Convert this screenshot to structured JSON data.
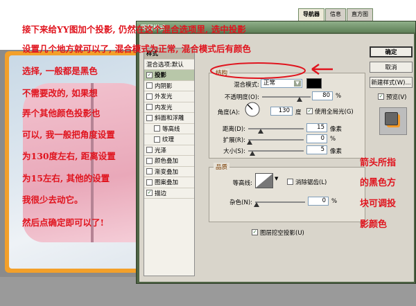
{
  "navigator": {
    "tabs": [
      "导航器",
      "信息",
      "直方图"
    ],
    "active": 0
  },
  "dialog": {
    "title": "图层样式",
    "style_list": {
      "header": "样式",
      "default_item": "混合选项:默认",
      "items": [
        {
          "label": "投影",
          "checked": true,
          "selected": true
        },
        {
          "label": "内阴影",
          "checked": false
        },
        {
          "label": "外发光",
          "checked": false
        },
        {
          "label": "内发光",
          "checked": false
        },
        {
          "label": "斜面和浮雕",
          "checked": false
        },
        {
          "label": "等高线",
          "checked": false,
          "indent": true
        },
        {
          "label": "纹理",
          "checked": false,
          "indent": true
        },
        {
          "label": "光泽",
          "checked": false
        },
        {
          "label": "颜色叠加",
          "checked": false
        },
        {
          "label": "渐变叠加",
          "checked": false
        },
        {
          "label": "图案叠加",
          "checked": false
        },
        {
          "label": "描边",
          "checked": true
        }
      ]
    },
    "structure": {
      "group_title": "结构",
      "blend_mode_label": "混合模式:",
      "blend_mode_value": "正常",
      "shadow_color": "#000000",
      "opacity_label": "不透明度(O):",
      "opacity_value": "80",
      "opacity_unit": "%",
      "angle_label": "角度(A):",
      "angle_value": "130",
      "angle_unit": "度",
      "global_light_label": "使用全局光(G)",
      "global_light_checked": true,
      "distance_label": "距离(D):",
      "distance_value": "15",
      "distance_unit": "像素",
      "spread_label": "扩展(R):",
      "spread_value": "0",
      "spread_unit": "%",
      "size_label": "大小(S):",
      "size_value": "5",
      "size_unit": "像素"
    },
    "quality": {
      "group_title": "品质",
      "contour_label": "等高线:",
      "antialias_label": "消除锯齿(L)",
      "antialias_checked": false,
      "noise_label": "杂色(N):",
      "noise_value": "0",
      "noise_unit": "%",
      "knockout_label": "图层挖空投影(U)",
      "knockout_checked": true
    },
    "buttons": {
      "ok": "确定",
      "cancel": "取消",
      "new_style": "新建样式(W)...",
      "preview_label": "预览(V)",
      "preview_checked": true
    }
  },
  "annotations": {
    "left_lines": [
      "接下来给YY图加个投影, 仍然在这个混合选项里, 选中投影",
      "设置几个地方就可以了, 混合模式为正常, 混合模式后有颜色",
      "选择, 一般都是黑色",
      "不需要改的, 如果想",
      "弄个其他颜色投影也",
      "可以, 我一般把角度设置",
      "为130度左右, 距离设置",
      "为15左右, 其他的设置",
      "我很少去动它。",
      "然后点确定即可以了!"
    ],
    "right_lines": [
      "箭头所指",
      "的黑色方",
      "块可调投",
      "影颜色"
    ]
  },
  "colors": {
    "annotation_red": "#e0141e",
    "dialog_frame": "#4f6445",
    "photo_border": "#f3a02a"
  }
}
